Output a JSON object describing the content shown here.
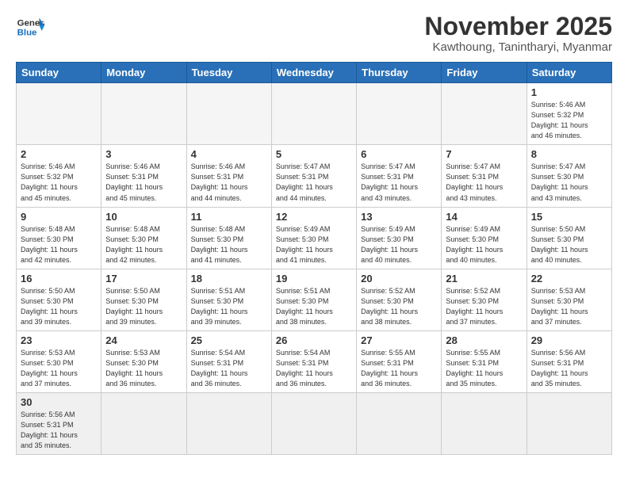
{
  "header": {
    "logo_general": "General",
    "logo_blue": "Blue",
    "month_title": "November 2025",
    "location": "Kawthoung, Tanintharyi, Myanmar"
  },
  "weekdays": [
    "Sunday",
    "Monday",
    "Tuesday",
    "Wednesday",
    "Thursday",
    "Friday",
    "Saturday"
  ],
  "weeks": [
    [
      {
        "day": "",
        "info": ""
      },
      {
        "day": "",
        "info": ""
      },
      {
        "day": "",
        "info": ""
      },
      {
        "day": "",
        "info": ""
      },
      {
        "day": "",
        "info": ""
      },
      {
        "day": "",
        "info": ""
      },
      {
        "day": "1",
        "info": "Sunrise: 5:46 AM\nSunset: 5:32 PM\nDaylight: 11 hours\nand 46 minutes."
      }
    ],
    [
      {
        "day": "2",
        "info": "Sunrise: 5:46 AM\nSunset: 5:32 PM\nDaylight: 11 hours\nand 45 minutes."
      },
      {
        "day": "3",
        "info": "Sunrise: 5:46 AM\nSunset: 5:31 PM\nDaylight: 11 hours\nand 45 minutes."
      },
      {
        "day": "4",
        "info": "Sunrise: 5:46 AM\nSunset: 5:31 PM\nDaylight: 11 hours\nand 44 minutes."
      },
      {
        "day": "5",
        "info": "Sunrise: 5:47 AM\nSunset: 5:31 PM\nDaylight: 11 hours\nand 44 minutes."
      },
      {
        "day": "6",
        "info": "Sunrise: 5:47 AM\nSunset: 5:31 PM\nDaylight: 11 hours\nand 43 minutes."
      },
      {
        "day": "7",
        "info": "Sunrise: 5:47 AM\nSunset: 5:31 PM\nDaylight: 11 hours\nand 43 minutes."
      },
      {
        "day": "8",
        "info": "Sunrise: 5:47 AM\nSunset: 5:30 PM\nDaylight: 11 hours\nand 43 minutes."
      }
    ],
    [
      {
        "day": "9",
        "info": "Sunrise: 5:48 AM\nSunset: 5:30 PM\nDaylight: 11 hours\nand 42 minutes."
      },
      {
        "day": "10",
        "info": "Sunrise: 5:48 AM\nSunset: 5:30 PM\nDaylight: 11 hours\nand 42 minutes."
      },
      {
        "day": "11",
        "info": "Sunrise: 5:48 AM\nSunset: 5:30 PM\nDaylight: 11 hours\nand 41 minutes."
      },
      {
        "day": "12",
        "info": "Sunrise: 5:49 AM\nSunset: 5:30 PM\nDaylight: 11 hours\nand 41 minutes."
      },
      {
        "day": "13",
        "info": "Sunrise: 5:49 AM\nSunset: 5:30 PM\nDaylight: 11 hours\nand 40 minutes."
      },
      {
        "day": "14",
        "info": "Sunrise: 5:49 AM\nSunset: 5:30 PM\nDaylight: 11 hours\nand 40 minutes."
      },
      {
        "day": "15",
        "info": "Sunrise: 5:50 AM\nSunset: 5:30 PM\nDaylight: 11 hours\nand 40 minutes."
      }
    ],
    [
      {
        "day": "16",
        "info": "Sunrise: 5:50 AM\nSunset: 5:30 PM\nDaylight: 11 hours\nand 39 minutes."
      },
      {
        "day": "17",
        "info": "Sunrise: 5:50 AM\nSunset: 5:30 PM\nDaylight: 11 hours\nand 39 minutes."
      },
      {
        "day": "18",
        "info": "Sunrise: 5:51 AM\nSunset: 5:30 PM\nDaylight: 11 hours\nand 39 minutes."
      },
      {
        "day": "19",
        "info": "Sunrise: 5:51 AM\nSunset: 5:30 PM\nDaylight: 11 hours\nand 38 minutes."
      },
      {
        "day": "20",
        "info": "Sunrise: 5:52 AM\nSunset: 5:30 PM\nDaylight: 11 hours\nand 38 minutes."
      },
      {
        "day": "21",
        "info": "Sunrise: 5:52 AM\nSunset: 5:30 PM\nDaylight: 11 hours\nand 37 minutes."
      },
      {
        "day": "22",
        "info": "Sunrise: 5:53 AM\nSunset: 5:30 PM\nDaylight: 11 hours\nand 37 minutes."
      }
    ],
    [
      {
        "day": "23",
        "info": "Sunrise: 5:53 AM\nSunset: 5:30 PM\nDaylight: 11 hours\nand 37 minutes."
      },
      {
        "day": "24",
        "info": "Sunrise: 5:53 AM\nSunset: 5:30 PM\nDaylight: 11 hours\nand 36 minutes."
      },
      {
        "day": "25",
        "info": "Sunrise: 5:54 AM\nSunset: 5:31 PM\nDaylight: 11 hours\nand 36 minutes."
      },
      {
        "day": "26",
        "info": "Sunrise: 5:54 AM\nSunset: 5:31 PM\nDaylight: 11 hours\nand 36 minutes."
      },
      {
        "day": "27",
        "info": "Sunrise: 5:55 AM\nSunset: 5:31 PM\nDaylight: 11 hours\nand 36 minutes."
      },
      {
        "day": "28",
        "info": "Sunrise: 5:55 AM\nSunset: 5:31 PM\nDaylight: 11 hours\nand 35 minutes."
      },
      {
        "day": "29",
        "info": "Sunrise: 5:56 AM\nSunset: 5:31 PM\nDaylight: 11 hours\nand 35 minutes."
      }
    ],
    [
      {
        "day": "30",
        "info": "Sunrise: 5:56 AM\nSunset: 5:31 PM\nDaylight: 11 hours\nand 35 minutes."
      },
      {
        "day": "",
        "info": ""
      },
      {
        "day": "",
        "info": ""
      },
      {
        "day": "",
        "info": ""
      },
      {
        "day": "",
        "info": ""
      },
      {
        "day": "",
        "info": ""
      },
      {
        "day": "",
        "info": ""
      }
    ]
  ]
}
